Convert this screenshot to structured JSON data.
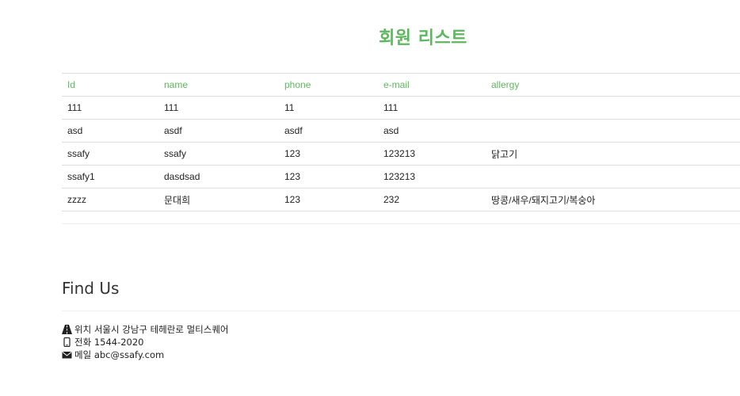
{
  "page": {
    "title": "회원 리스트"
  },
  "member_table": {
    "columns": [
      "Id",
      "name",
      "phone",
      "e-mail",
      "allergy"
    ],
    "rows": [
      [
        "111",
        "111",
        "11",
        "111",
        ""
      ],
      [
        "asd",
        "asdf",
        "asdf",
        "asd",
        ""
      ],
      [
        "ssafy",
        "ssafy",
        "123",
        "123213",
        "닭고기"
      ],
      [
        "ssafy1",
        "dasdsad",
        "123",
        "123213",
        ""
      ],
      [
        "zzzz",
        "문대희",
        "123",
        "232",
        "땅콩/새우/돼지고기/복숭아"
      ]
    ]
  },
  "find_us": {
    "title": "Find Us",
    "location": {
      "icon": "road-icon",
      "text": "위치 서울시 강남구 테헤란로 멀티스퀘어"
    },
    "phone": {
      "icon": "mobile-phone-icon",
      "text": "전화 1544-2020"
    },
    "email": {
      "icon": "envelope-icon",
      "text": "메일 abc@ssafy.com"
    }
  },
  "colors": {
    "accent": "#5cb85c",
    "text": "#222222",
    "rule": "#dddddd"
  }
}
